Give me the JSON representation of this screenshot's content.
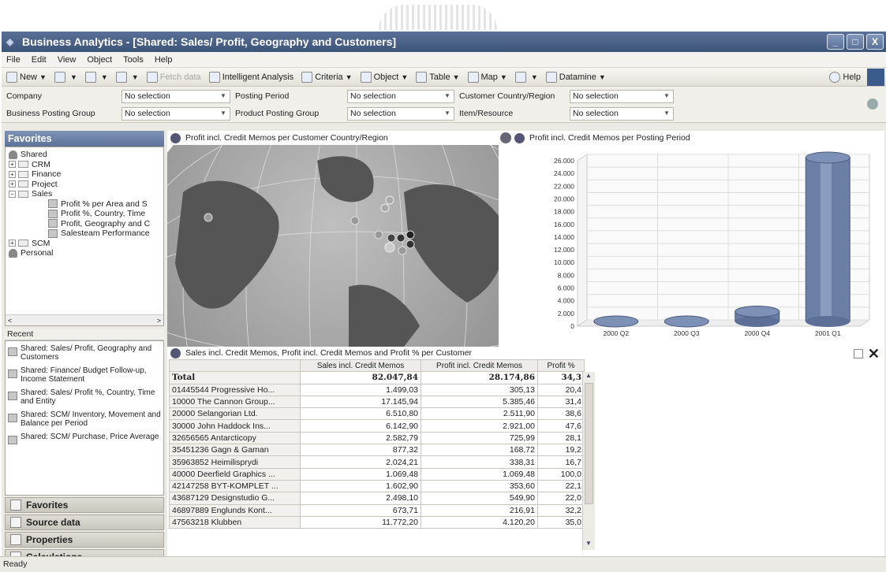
{
  "window": {
    "title": "Business Analytics - [Shared: Sales/ Profit, Geography and Customers]",
    "controls": [
      "_",
      "□",
      "X"
    ]
  },
  "menu": [
    "File",
    "Edit",
    "View",
    "Object",
    "Tools",
    "Help"
  ],
  "toolbar": {
    "new": "New",
    "fetch": "Fetch data",
    "intelligent": "Intelligent Analysis",
    "criteria": "Criteria",
    "object": "Object",
    "table": "Table",
    "map": "Map",
    "datamine": "Datamine",
    "help": "Help"
  },
  "filters": {
    "company": {
      "label": "Company",
      "value": "No selection"
    },
    "posting_period": {
      "label": "Posting Period",
      "value": "No selection"
    },
    "customer_country": {
      "label": "Customer Country/Region",
      "value": "No selection"
    },
    "business_group": {
      "label": "Business Posting Group",
      "value": "No selection"
    },
    "product_group": {
      "label": "Product Posting Group",
      "value": "No selection"
    },
    "item_resource": {
      "label": "Item/Resource",
      "value": "No selection"
    }
  },
  "favorites": {
    "header": "Favorites",
    "shared": "Shared",
    "folders": [
      "CRM",
      "Finance",
      "Project",
      "Sales"
    ],
    "sales_items": [
      "Profit % per Area and S",
      "Profit %, Country, Time",
      "Profit, Geography and C",
      "Salesteam Performance"
    ],
    "scm": "SCM",
    "personal": "Personal"
  },
  "recent": {
    "header": "Recent",
    "items": [
      "Shared: Sales/ Profit, Geography and Customers",
      "Shared: Finance/ Budget Follow-up, Income Statement",
      "Shared: Sales/ Profit %, Country, Time and Entity",
      "Shared: SCM/ Inventory, Movement and Balance per Period",
      "Shared: SCM/ Purchase, Price Average"
    ]
  },
  "accordion": [
    "Favorites",
    "Source data",
    "Properties",
    "Calculations"
  ],
  "map_panel": {
    "title": "Profit incl. Credit Memos per Customer Country/Region"
  },
  "chart_panel": {
    "title": "Profit incl. Credit Memos per Posting Period"
  },
  "chart_data": {
    "type": "bar",
    "title": "Profit incl. Credit Memos per Posting Period",
    "categories": [
      "2000 Q2",
      "2000 Q3",
      "2000 Q4",
      "2001 Q1"
    ],
    "values": [
      0,
      0,
      1800,
      26000
    ],
    "yticks": [
      "0",
      "2.000",
      "4.000",
      "6.000",
      "8.000",
      "10.000",
      "12.000",
      "14.000",
      "16.000",
      "18.000",
      "20.000",
      "22.000",
      "24.000",
      "26.000"
    ],
    "ylim": [
      0,
      26000
    ],
    "xlabel": "",
    "ylabel": "",
    "grid": true
  },
  "table_panel": {
    "title": "Sales incl. Credit Memos, Profit incl. Credit Memos and Profit % per Customer",
    "headers": [
      "Sales incl. Credit Memos",
      "Profit incl. Credit Memos",
      "Profit %"
    ],
    "total": {
      "label": "Total",
      "sales": "82.047,84",
      "profit": "28.174,86",
      "pct": "34,3"
    },
    "rows": [
      {
        "name": "01445544  Progressive Ho...",
        "sales": "1.499,03",
        "profit": "305,13",
        "pct": "20,4"
      },
      {
        "name": "10000  The Cannon Group...",
        "sales": "17.145,94",
        "profit": "5.385,46",
        "pct": "31,4"
      },
      {
        "name": "20000  Selangorian Ltd.",
        "sales": "6.510,80",
        "profit": "2.511,90",
        "pct": "38,6"
      },
      {
        "name": "30000  John Haddock Ins...",
        "sales": "6.142,90",
        "profit": "2.921,00",
        "pct": "47,6"
      },
      {
        "name": "32656565  Antarcticopy",
        "sales": "2.582,79",
        "profit": "725,99",
        "pct": "28,1"
      },
      {
        "name": "35451236  Gagn & Gaman",
        "sales": "877,32",
        "profit": "168,72",
        "pct": "19,2"
      },
      {
        "name": "35963852  Heimilisprydi",
        "sales": "2.024,21",
        "profit": "338,31",
        "pct": "16,7"
      },
      {
        "name": "40000  Deerfield Graphics ...",
        "sales": "1.069,48",
        "profit": "1.069,48",
        "pct": "100,0"
      },
      {
        "name": "42147258  BYT-KOMPLET ...",
        "sales": "1.602,90",
        "profit": "353,60",
        "pct": "22,1"
      },
      {
        "name": "43687129  Designstudio G...",
        "sales": "2.498,10",
        "profit": "549,90",
        "pct": "22,0"
      },
      {
        "name": "46897889  Englunds Kont...",
        "sales": "673,71",
        "profit": "216,91",
        "pct": "32,2"
      },
      {
        "name": "47563218  Klubben",
        "sales": "11.772,20",
        "profit": "4.120,20",
        "pct": "35,0"
      }
    ]
  },
  "status": "Ready"
}
